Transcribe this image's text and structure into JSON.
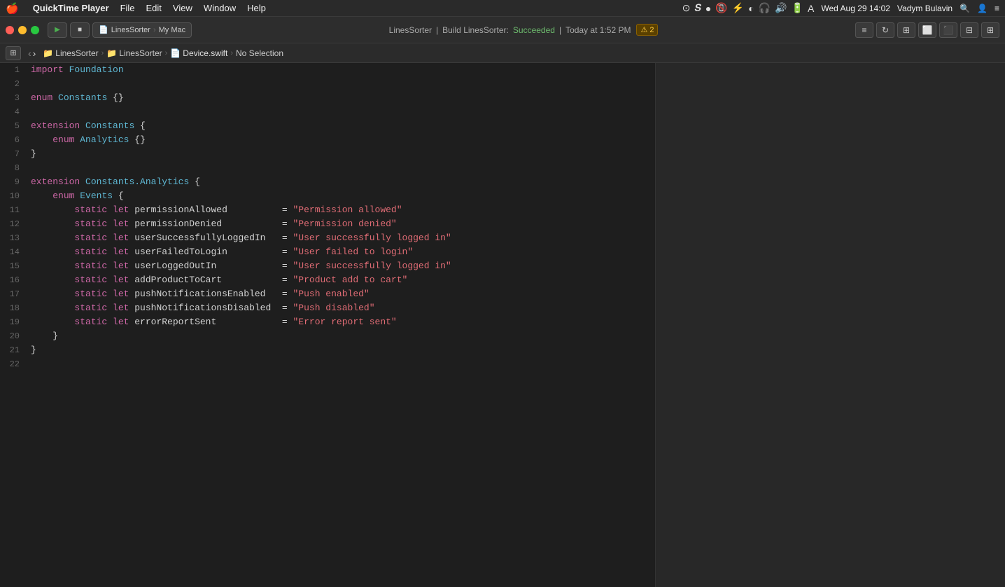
{
  "menubar": {
    "apple": "🍎",
    "app_name": "QuickTime Player",
    "menus": [
      "File",
      "Edit",
      "View",
      "Window",
      "Help"
    ],
    "time": "Wed Aug 29  14:02",
    "user": "Vadym Bulavin",
    "icons": [
      "⊙",
      "S",
      "👤",
      "📞",
      "⚡",
      "◑",
      "🎧",
      "🔊",
      "🔋",
      "A"
    ]
  },
  "toolbar": {
    "scheme": "LinesSorter",
    "device": "My Mac",
    "file_name": "LinesSorter",
    "build_label": "Build LinesSorter:",
    "build_status": "Succeeded",
    "build_time": "Today at 1:52 PM",
    "warning_count": "2"
  },
  "breadcrumb": {
    "items": [
      {
        "label": "LinesSorter",
        "type": "folder"
      },
      {
        "label": "LinesSorter",
        "type": "folder"
      },
      {
        "label": "Device.swift",
        "type": "file"
      },
      {
        "label": "No Selection",
        "type": "text"
      }
    ]
  },
  "code": {
    "lines": [
      {
        "num": 1,
        "tokens": [
          {
            "t": "kw-import",
            "v": "import"
          },
          {
            "t": "plain",
            "v": " "
          },
          {
            "t": "type-name",
            "v": "Foundation"
          }
        ]
      },
      {
        "num": 2,
        "tokens": []
      },
      {
        "num": 3,
        "tokens": [
          {
            "t": "kw-enum",
            "v": "enum"
          },
          {
            "t": "plain",
            "v": " "
          },
          {
            "t": "type-name",
            "v": "Constants"
          },
          {
            "t": "plain",
            "v": " {}"
          }
        ]
      },
      {
        "num": 4,
        "tokens": []
      },
      {
        "num": 5,
        "tokens": [
          {
            "t": "kw-extension",
            "v": "extension"
          },
          {
            "t": "plain",
            "v": " "
          },
          {
            "t": "type-name",
            "v": "Constants"
          },
          {
            "t": "plain",
            "v": " {"
          }
        ]
      },
      {
        "num": 6,
        "tokens": [
          {
            "t": "plain",
            "v": "    "
          },
          {
            "t": "kw-enum",
            "v": "enum"
          },
          {
            "t": "plain",
            "v": " "
          },
          {
            "t": "type-name",
            "v": "Analytics"
          },
          {
            "t": "plain",
            "v": " {}"
          }
        ]
      },
      {
        "num": 7,
        "tokens": [
          {
            "t": "plain",
            "v": "}"
          }
        ]
      },
      {
        "num": 8,
        "tokens": []
      },
      {
        "num": 9,
        "tokens": [
          {
            "t": "kw-extension",
            "v": "extension"
          },
          {
            "t": "plain",
            "v": " "
          },
          {
            "t": "type-name",
            "v": "Constants.Analytics"
          },
          {
            "t": "plain",
            "v": " {"
          }
        ]
      },
      {
        "num": 10,
        "tokens": [
          {
            "t": "plain",
            "v": "    "
          },
          {
            "t": "kw-enum",
            "v": "enum"
          },
          {
            "t": "plain",
            "v": " "
          },
          {
            "t": "type-name",
            "v": "Events"
          },
          {
            "t": "plain",
            "v": " {"
          }
        ]
      },
      {
        "num": 11,
        "tokens": [
          {
            "t": "plain",
            "v": "        "
          },
          {
            "t": "kw-static",
            "v": "static"
          },
          {
            "t": "plain",
            "v": " "
          },
          {
            "t": "kw-let",
            "v": "let"
          },
          {
            "t": "plain",
            "v": " permissionAllowed          = "
          },
          {
            "t": "string-val",
            "v": "\"Permission allowed\""
          }
        ]
      },
      {
        "num": 12,
        "tokens": [
          {
            "t": "plain",
            "v": "        "
          },
          {
            "t": "kw-static",
            "v": "static"
          },
          {
            "t": "plain",
            "v": " "
          },
          {
            "t": "kw-let",
            "v": "let"
          },
          {
            "t": "plain",
            "v": " permissionDenied           = "
          },
          {
            "t": "string-val",
            "v": "\"Permission denied\""
          }
        ]
      },
      {
        "num": 13,
        "tokens": [
          {
            "t": "plain",
            "v": "        "
          },
          {
            "t": "kw-static",
            "v": "static"
          },
          {
            "t": "plain",
            "v": " "
          },
          {
            "t": "kw-let",
            "v": "let"
          },
          {
            "t": "plain",
            "v": " userSuccessfullyLoggedIn   = "
          },
          {
            "t": "string-val",
            "v": "\"User successfully logged in\""
          }
        ]
      },
      {
        "num": 14,
        "tokens": [
          {
            "t": "plain",
            "v": "        "
          },
          {
            "t": "kw-static",
            "v": "static"
          },
          {
            "t": "plain",
            "v": " "
          },
          {
            "t": "kw-let",
            "v": "let"
          },
          {
            "t": "plain",
            "v": " userFailedToLogin          = "
          },
          {
            "t": "string-val",
            "v": "\"User failed to login\""
          }
        ]
      },
      {
        "num": 15,
        "tokens": [
          {
            "t": "plain",
            "v": "        "
          },
          {
            "t": "kw-static",
            "v": "static"
          },
          {
            "t": "plain",
            "v": " "
          },
          {
            "t": "kw-let",
            "v": "let"
          },
          {
            "t": "plain",
            "v": " userLoggedOutIn            = "
          },
          {
            "t": "string-val",
            "v": "\"User successfully logged in\""
          }
        ]
      },
      {
        "num": 16,
        "tokens": [
          {
            "t": "plain",
            "v": "        "
          },
          {
            "t": "kw-static",
            "v": "static"
          },
          {
            "t": "plain",
            "v": " "
          },
          {
            "t": "kw-let",
            "v": "let"
          },
          {
            "t": "plain",
            "v": " addProductToCart           = "
          },
          {
            "t": "string-val",
            "v": "\"Product add to cart\""
          }
        ]
      },
      {
        "num": 17,
        "tokens": [
          {
            "t": "plain",
            "v": "        "
          },
          {
            "t": "kw-static",
            "v": "static"
          },
          {
            "t": "plain",
            "v": " "
          },
          {
            "t": "kw-let",
            "v": "let"
          },
          {
            "t": "plain",
            "v": " pushNotificationsEnabled   = "
          },
          {
            "t": "string-val",
            "v": "\"Push enabled\""
          }
        ]
      },
      {
        "num": 18,
        "tokens": [
          {
            "t": "plain",
            "v": "        "
          },
          {
            "t": "kw-static",
            "v": "static"
          },
          {
            "t": "plain",
            "v": " "
          },
          {
            "t": "kw-let",
            "v": "let"
          },
          {
            "t": "plain",
            "v": " pushNotificationsDisabled  = "
          },
          {
            "t": "string-val",
            "v": "\"Push disabled\""
          }
        ]
      },
      {
        "num": 19,
        "tokens": [
          {
            "t": "plain",
            "v": "        "
          },
          {
            "t": "kw-static",
            "v": "static"
          },
          {
            "t": "plain",
            "v": " "
          },
          {
            "t": "kw-let",
            "v": "let"
          },
          {
            "t": "plain",
            "v": " errorReportSent            = "
          },
          {
            "t": "string-val",
            "v": "\"Error report sent\""
          }
        ]
      },
      {
        "num": 20,
        "tokens": [
          {
            "t": "plain",
            "v": "    }"
          }
        ]
      },
      {
        "num": 21,
        "tokens": [
          {
            "t": "plain",
            "v": "}"
          }
        ]
      },
      {
        "num": 22,
        "tokens": []
      }
    ]
  }
}
